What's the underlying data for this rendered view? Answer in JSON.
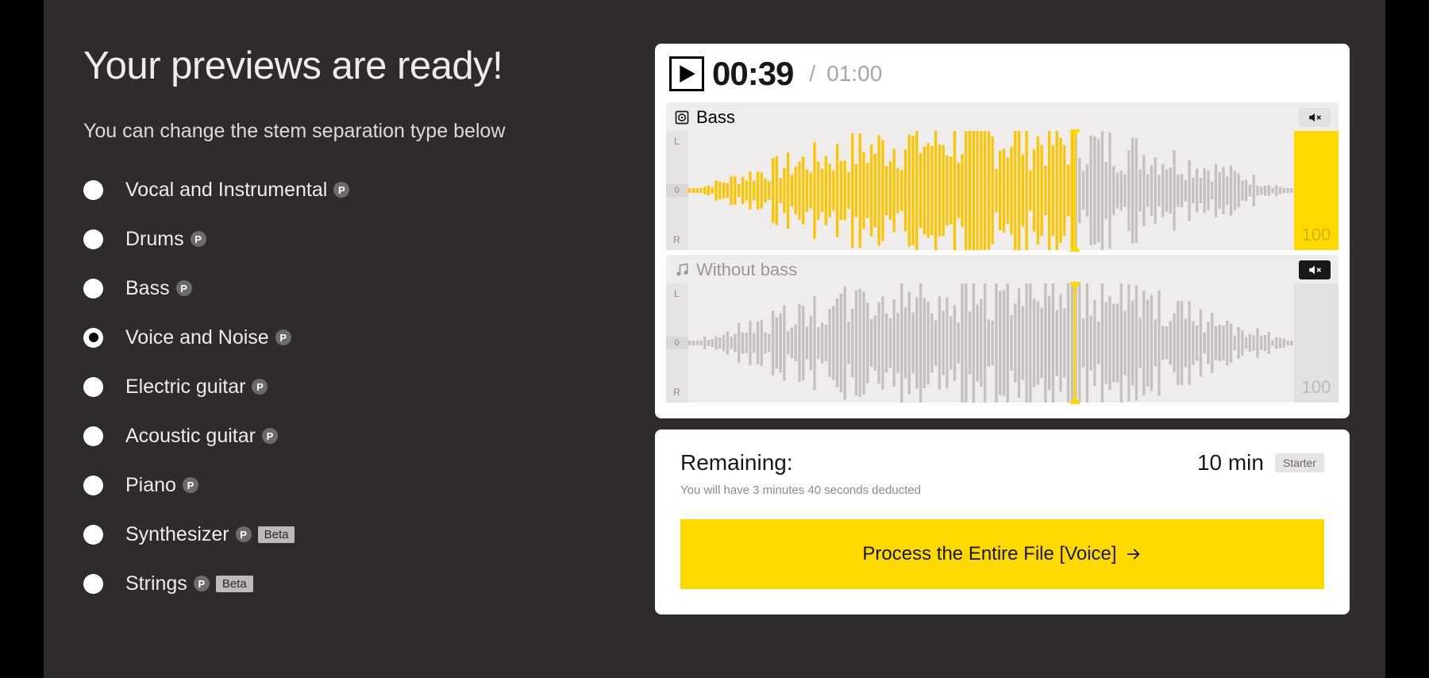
{
  "heading": "Your previews are ready!",
  "subheading": "You can change the stem separation type below",
  "options": [
    {
      "label": "Vocal and Instrumental",
      "selected": false,
      "p": true,
      "beta": false
    },
    {
      "label": "Drums",
      "selected": false,
      "p": true,
      "beta": false
    },
    {
      "label": "Bass",
      "selected": false,
      "p": true,
      "beta": false
    },
    {
      "label": "Voice and Noise",
      "selected": true,
      "p": true,
      "beta": false
    },
    {
      "label": "Electric guitar",
      "selected": false,
      "p": true,
      "beta": false
    },
    {
      "label": "Acoustic guitar",
      "selected": false,
      "p": true,
      "beta": false
    },
    {
      "label": "Piano",
      "selected": false,
      "p": true,
      "beta": false
    },
    {
      "label": "Synthesizer",
      "selected": false,
      "p": true,
      "beta": true
    },
    {
      "label": "Strings",
      "selected": false,
      "p": true,
      "beta": true
    }
  ],
  "beta_label": "Beta",
  "p_label": "P",
  "player": {
    "current": "00:39",
    "separator": "/",
    "total": "01:00",
    "progress_fraction": 0.636
  },
  "tracks": [
    {
      "name": "Bass",
      "muted": false,
      "volume": "100",
      "icon": "speaker"
    },
    {
      "name": "Without bass",
      "muted": true,
      "volume": "100",
      "icon": "note"
    }
  ],
  "channel_labels": {
    "left": "L",
    "center": "0",
    "right": "R"
  },
  "remaining": {
    "label": "Remaining:",
    "time": "10 min",
    "plan": "Starter",
    "deduction": "You will have 3 minutes 40 seconds deducted"
  },
  "process_label": "Process the Entire File [Voice]"
}
